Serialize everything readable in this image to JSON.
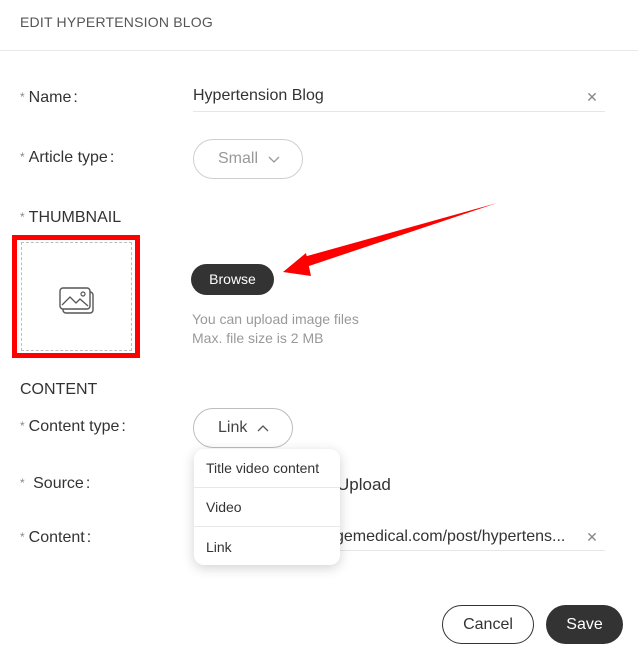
{
  "modal": {
    "title": "EDIT HYPERTENSION BLOG"
  },
  "form": {
    "required_mark": "*",
    "name": {
      "label": "Name",
      "colon": ":",
      "value": "Hypertension Blog",
      "clear_icon": "close-icon"
    },
    "article_type": {
      "label": "Article type",
      "colon": ":",
      "value": "Small",
      "chevron_icon": "chevron-down-icon"
    },
    "thumbnail": {
      "label": "THUMBNAIL",
      "placeholder_icon": "image-icon",
      "browse_label": "Browse",
      "hint_line1": "You can upload image files",
      "hint_line2": "Max. file size is 2 MB",
      "highlight_color": "#ff0000"
    },
    "content_section": {
      "title": "CONTENT"
    },
    "content_type": {
      "label": "Content type",
      "colon": ":",
      "value": "Link",
      "chevron_icon": "chevron-up-icon",
      "options": [
        "Title video content",
        "Video",
        "Link"
      ]
    },
    "source": {
      "label": "Source",
      "colon": ":",
      "value": "Upload"
    },
    "content": {
      "label": "Content",
      "colon": ":",
      "value": "gemedical.com/post/hypertens...",
      "clear_icon": "close-icon"
    }
  },
  "footer": {
    "cancel_label": "Cancel",
    "save_label": "Save"
  },
  "annotation": {
    "arrow_color": "#ff0000"
  },
  "colors": {
    "primary_dark": "#333333",
    "muted_text": "#999999",
    "border": "#cfcfcf"
  }
}
